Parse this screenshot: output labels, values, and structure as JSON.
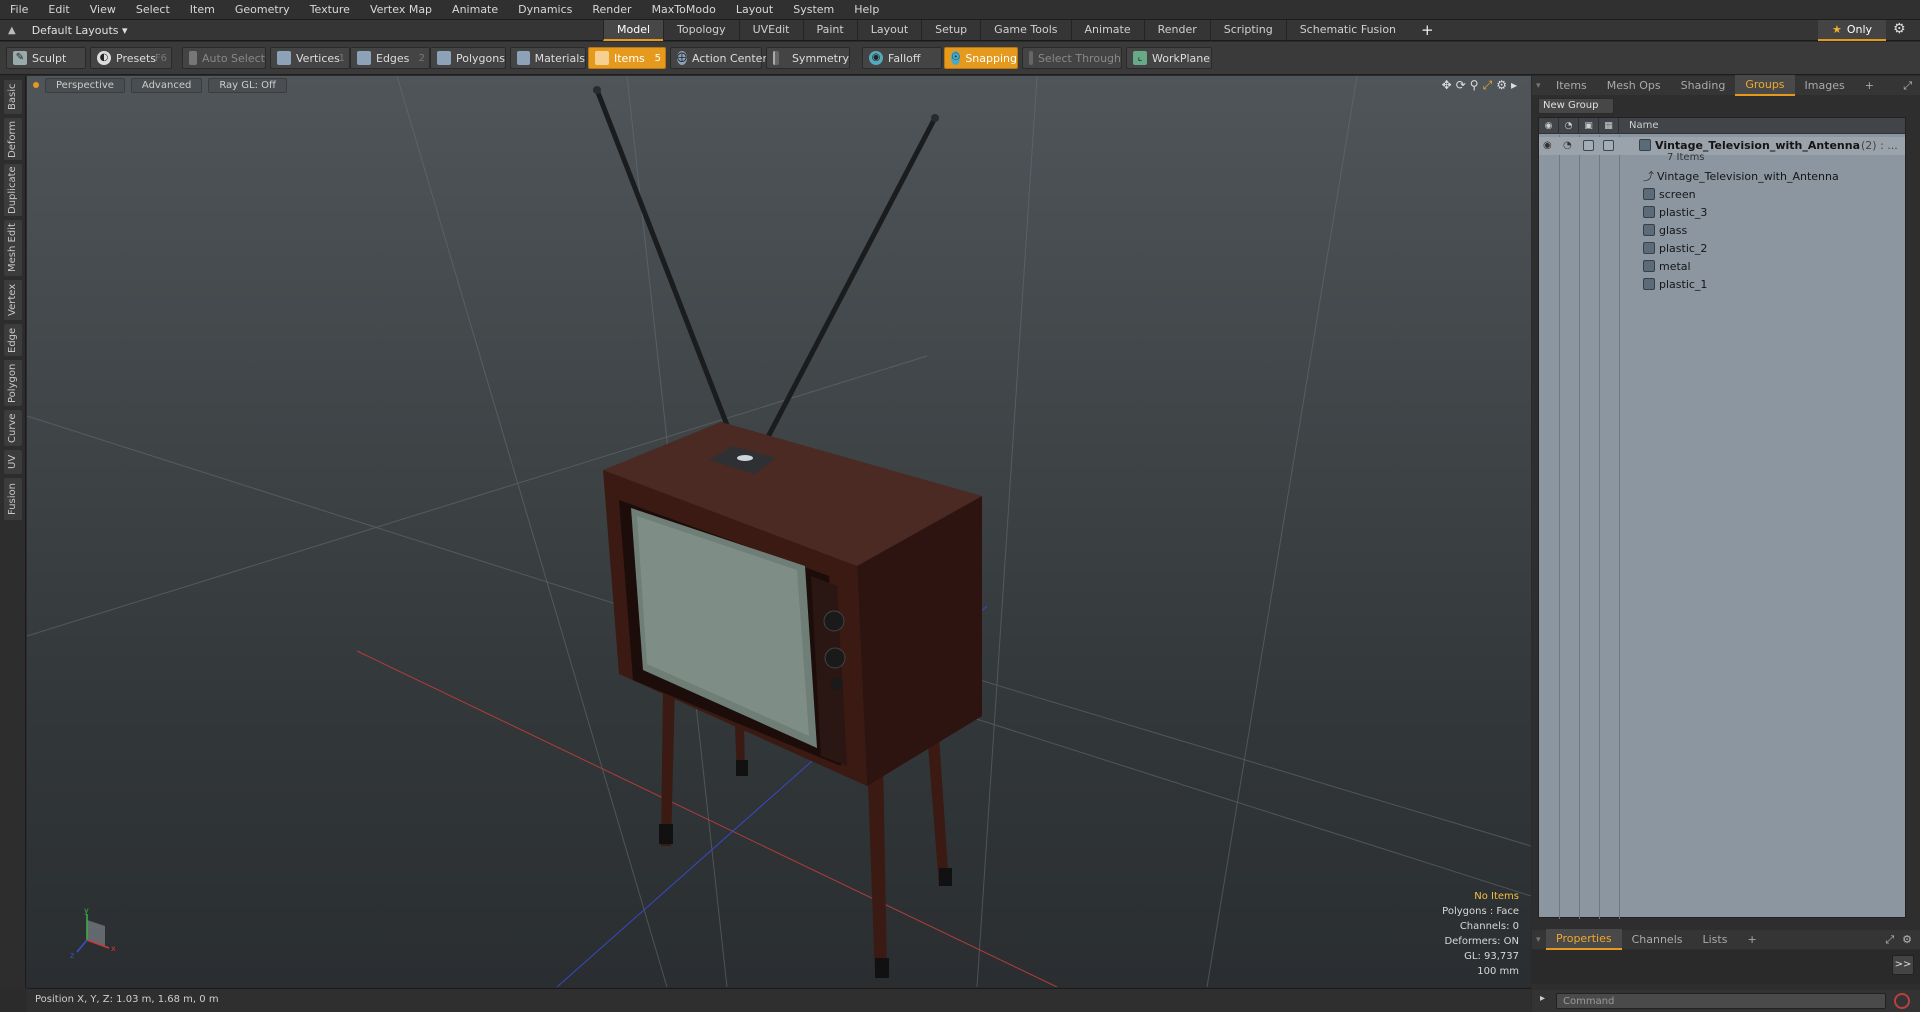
{
  "menu": [
    "File",
    "Edit",
    "View",
    "Select",
    "Item",
    "Geometry",
    "Texture",
    "Vertex Map",
    "Animate",
    "Dynamics",
    "Render",
    "MaxToModo",
    "Layout",
    "System",
    "Help"
  ],
  "layout_bar": {
    "layout_select": "Default Layouts ▾",
    "tabs": [
      "Model",
      "Topology",
      "UVEdit",
      "Paint",
      "Layout",
      "Setup",
      "Game Tools",
      "Animate",
      "Render",
      "Scripting",
      "Schematic Fusion"
    ],
    "active_tab": "Model",
    "add": "+",
    "only": "Only"
  },
  "toolbar": {
    "sculpt": "Sculpt",
    "presets": "Presets",
    "presets_key": "F6",
    "auto_select": "Auto Select",
    "vertices": "Vertices",
    "vertices_num": "1",
    "edges": "Edges",
    "edges_num": "2",
    "polygons": "Polygons",
    "materials": "Materials",
    "items": "Items",
    "items_num": "5",
    "action_center": "Action Center",
    "symmetry": "Symmetry",
    "falloff": "Falloff",
    "snapping": "Snapping",
    "select_through": "Select Through",
    "workplane": "WorkPlane"
  },
  "left_tabs": [
    "Basic",
    "Deform",
    "Duplicate",
    "Mesh Edit",
    "Vertex",
    "Edge",
    "Polygon",
    "Curve",
    "UV",
    "Fusion"
  ],
  "viewport": {
    "view": "Perspective",
    "shading": "Advanced",
    "raygl": "Ray GL: Off",
    "stats": {
      "no_items": "No Items",
      "polygons": "Polygons : Face",
      "channels": "Channels: 0",
      "deformers": "Deformers: ON",
      "gl": "GL: 93,737",
      "scale": "100 mm"
    },
    "axis": {
      "y": "y",
      "x": "x",
      "z": "z"
    }
  },
  "status": {
    "position": "Position X, Y, Z:   1.03 m, 1.68 m, 0 m"
  },
  "right_panel": {
    "tabs": [
      "Items",
      "Mesh Ops",
      "Shading",
      "Groups",
      "Images",
      "+"
    ],
    "active_tab": "Groups",
    "new_group": "New Group",
    "name_header": "Name",
    "group": {
      "name": "Vintage_Television_with_Antenna",
      "count_label": "(2) : ...",
      "items_label": "7 Items",
      "children": [
        "Vintage_Television_with_Antenna",
        "screen",
        "plastic_3",
        "glass",
        "plastic_2",
        "metal",
        "plastic_1"
      ]
    },
    "bottom_tabs": [
      "Properties",
      "Channels",
      "Lists",
      "+"
    ],
    "bottom_active": "Properties",
    "command_placeholder": "Command",
    "expand": ">>"
  },
  "colors": {
    "accent": "#e59a1e",
    "tree_bg": "#8c96a0",
    "viewport_top": "#4f5559",
    "viewport_bottom": "#2a2e31"
  },
  "icons": [
    "sculpt-icon",
    "presets-icon",
    "vertices-icon",
    "edges-icon",
    "polygons-icon",
    "materials-icon",
    "items-icon",
    "action-center-icon",
    "symmetry-icon",
    "falloff-icon",
    "snapping-icon",
    "workplane-icon",
    "gear-icon",
    "star-icon",
    "mesh-icon",
    "locator-icon"
  ]
}
